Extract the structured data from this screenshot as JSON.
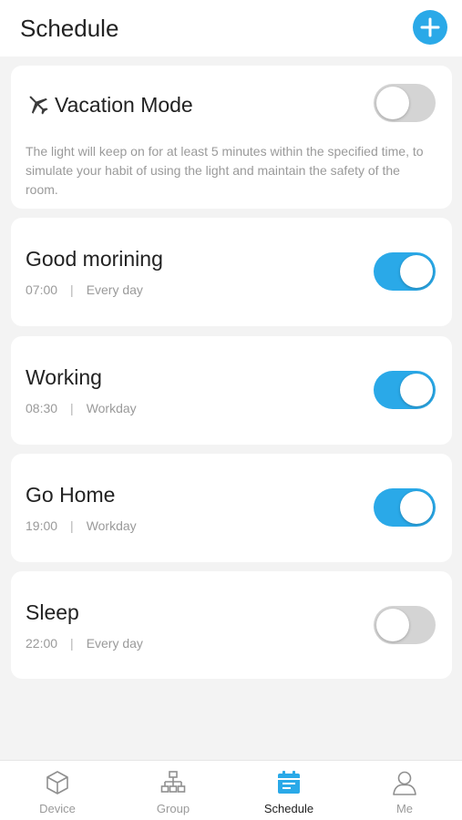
{
  "header": {
    "title": "Schedule",
    "add_icon": "plus-icon"
  },
  "vacation": {
    "icon": "airplane-icon",
    "title": "Vacation Mode",
    "description": "The light will keep on for at least 5 minutes within the specified time, to simulate your habit of using the light and maintain the safety of the room.",
    "enabled": false
  },
  "schedules": [
    {
      "name": "Good morining",
      "time": "07:00",
      "separator": "|",
      "repeat": "Every day",
      "enabled": true
    },
    {
      "name": "Working",
      "time": "08:30",
      "separator": "|",
      "repeat": "Workday",
      "enabled": true
    },
    {
      "name": "Go Home",
      "time": "19:00",
      "separator": "|",
      "repeat": "Workday",
      "enabled": true
    },
    {
      "name": "Sleep",
      "time": "22:00",
      "separator": "|",
      "repeat": "Every day",
      "enabled": false
    }
  ],
  "bottom_nav": {
    "active": "Schedule",
    "items": [
      {
        "label": "Device",
        "icon": "cube-icon"
      },
      {
        "label": "Group",
        "icon": "hierarchy-icon"
      },
      {
        "label": "Schedule",
        "icon": "calendar-icon"
      },
      {
        "label": "Me",
        "icon": "user-icon"
      }
    ]
  },
  "colors": {
    "accent": "#2aa9e8",
    "toggle_off": "#d4d4d4",
    "background": "#f3f3f3",
    "muted_text": "#9a9a9a"
  }
}
